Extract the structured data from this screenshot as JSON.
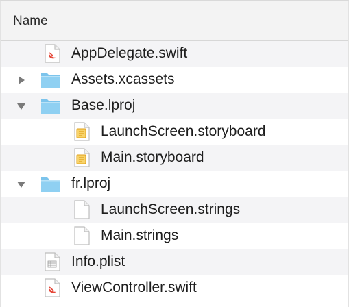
{
  "header": {
    "column_label": "Name"
  },
  "tree": [
    {
      "label": "AppDelegate.swift",
      "icon": "swift-file-icon",
      "depth": 1,
      "kind": "file"
    },
    {
      "label": "Assets.xcassets",
      "icon": "folder-icon",
      "depth": 0,
      "kind": "folder",
      "expanded": false
    },
    {
      "label": "Base.lproj",
      "icon": "folder-icon",
      "depth": 0,
      "kind": "folder",
      "expanded": true
    },
    {
      "label": "LaunchScreen.storyboard",
      "icon": "storyboard-file-icon",
      "depth": 2,
      "kind": "file"
    },
    {
      "label": "Main.storyboard",
      "icon": "storyboard-file-icon",
      "depth": 2,
      "kind": "file"
    },
    {
      "label": "fr.lproj",
      "icon": "folder-icon",
      "depth": 0,
      "kind": "folder",
      "expanded": true
    },
    {
      "label": "LaunchScreen.strings",
      "icon": "strings-file-icon",
      "depth": 2,
      "kind": "file"
    },
    {
      "label": "Main.strings",
      "icon": "strings-file-icon",
      "depth": 2,
      "kind": "file"
    },
    {
      "label": "Info.plist",
      "icon": "plist-file-icon",
      "depth": 1,
      "kind": "file"
    },
    {
      "label": "ViewController.swift",
      "icon": "swift-file-icon",
      "depth": 1,
      "kind": "file"
    }
  ],
  "colors": {
    "folder": "#7cc4ec",
    "swift": "#e5483a",
    "storyboard": "#e2a11a",
    "row_alt": "#f4f4f6",
    "header_bg": "#f3f3f3"
  }
}
